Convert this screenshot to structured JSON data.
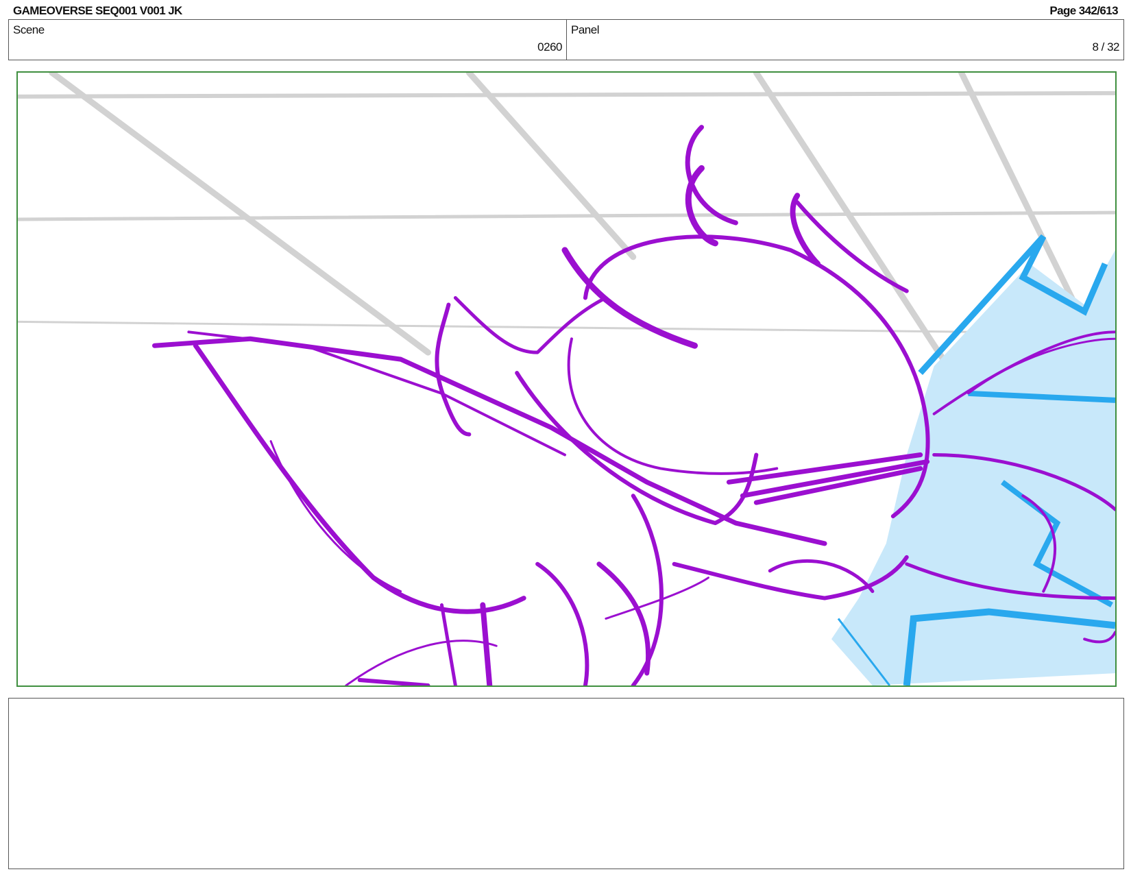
{
  "header": {
    "title": "GAMEOVERSE SEQ001 V001 JK",
    "page": "Page 342/613"
  },
  "info": {
    "scene_label": "Scene",
    "scene_value": "0260",
    "panel_label": "Panel",
    "panel_value": "8 / 32"
  },
  "artwork": {
    "line_color": "#9b0fd0",
    "effect_color": "#29a8ee",
    "effect_fill": "#c8e8fa",
    "grid_color": "#d2d2d2"
  },
  "notes": {
    "text": ""
  }
}
